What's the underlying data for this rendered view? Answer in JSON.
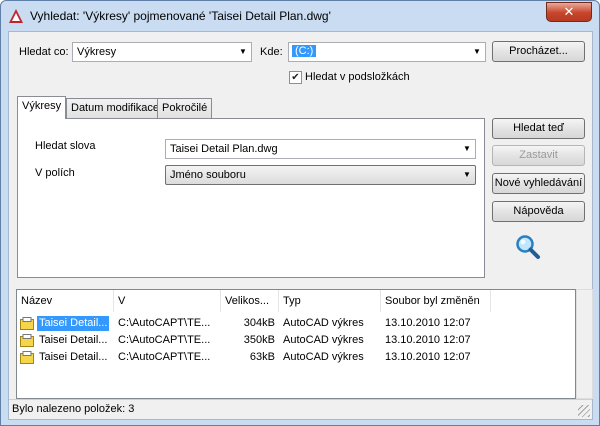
{
  "window": {
    "title": "Vyhledat: 'Výkresy' pojmenované 'Taisei Detail Plan.dwg'",
    "close_glyph": "✕",
    "accent": "#c7452b"
  },
  "search": {
    "look_for_label": "Hledat co:",
    "look_for_value": "Výkresy",
    "where_label": "Kde:",
    "where_value": "(C:)",
    "browse_label": "Procházet...",
    "subfolders_label": "Hledat v podsložkách",
    "subfolders_checked": true
  },
  "tabs": [
    {
      "label": "Výkresy",
      "active": true
    },
    {
      "label": "Datum modifikace",
      "active": false
    },
    {
      "label": "Pokročilé",
      "active": false
    }
  ],
  "panel": {
    "words_label": "Hledat slova",
    "words_value": "Taisei Detail Plan.dwg",
    "fields_label": "V polích",
    "fields_value": "Jméno souboru"
  },
  "actions": {
    "find_now": "Hledat teď",
    "stop": "Zastavit",
    "new_search": "Nové vyhledávání",
    "help": "Nápověda"
  },
  "results": {
    "columns": [
      "Název",
      "V",
      "Velikos...",
      "Typ",
      "Soubor byl změněn"
    ],
    "rows": [
      {
        "name": "Taisei Detail...",
        "folder": "C:\\AutoCAPT\\TE...",
        "size": "304kB",
        "type": "AutoCAD výkres",
        "modified": "13.10.2010 12:07"
      },
      {
        "name": "Taisei Detail...",
        "folder": "C:\\AutoCAPT\\TE...",
        "size": "350kB",
        "type": "AutoCAD výkres",
        "modified": "13.10.2010 12:07"
      },
      {
        "name": "Taisei Detail...",
        "folder": "C:\\AutoCAPT\\TE...",
        "size": "63kB",
        "type": "AutoCAD výkres",
        "modified": "13.10.2010 12:07"
      }
    ]
  },
  "status": {
    "text": "Bylo nalezeno položek: 3"
  },
  "icons": {
    "app": "autocad-icon",
    "search": "magnifier-icon",
    "file": "dwg-file-icon",
    "dropdown": "chevron-down-icon"
  },
  "colors": {
    "selection": "#3399ff",
    "frame": "#c9dcf1"
  }
}
